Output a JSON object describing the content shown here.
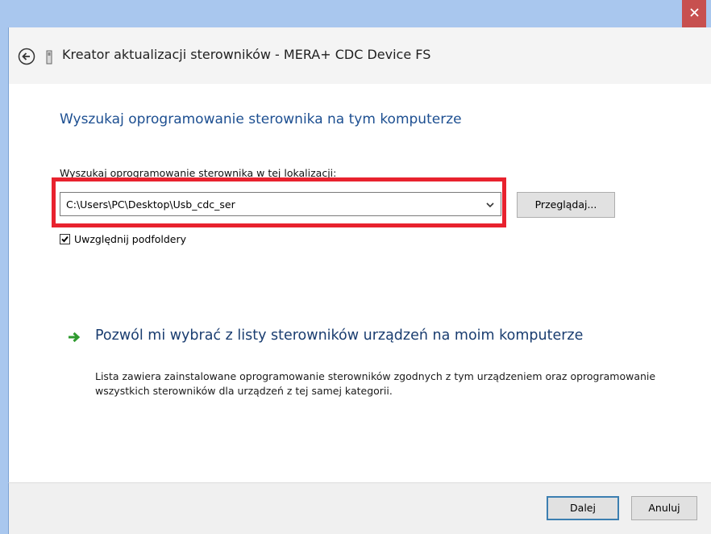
{
  "window": {
    "title": "Kreator aktualizacji sterowników - MERA+ CDC Device FS"
  },
  "page": {
    "title": "Wyszukaj oprogramowanie sterownika na tym komputerze",
    "location_label": "Wyszukaj oprogramowanie sterownika w tej lokalizacji:",
    "path_value": "C:\\Users\\PC\\Desktop\\Usb_cdc_ser",
    "browse_label": "Przeglądaj...",
    "include_subfolders_label": "Uwzględnij podfoldery",
    "include_subfolders_checked": true,
    "highlight_color": "#e8222e"
  },
  "option": {
    "title": "Pozwól mi wybrać z listy sterowników urządzeń na moim komputerze",
    "description": "Lista zawiera zainstalowane oprogramowanie sterowników zgodnych z tym urządzeniem oraz oprogramowanie wszystkich sterowników dla urządzeń z tej samej kategorii."
  },
  "footer": {
    "next_label": "Dalej",
    "cancel_label": "Anuluj"
  },
  "icons": {
    "close": "close-icon",
    "back": "back-arrow-icon",
    "device": "device-icon",
    "dropdown": "chevron-down-icon",
    "check": "checkmark-icon",
    "link_arrow": "green-arrow-icon"
  }
}
